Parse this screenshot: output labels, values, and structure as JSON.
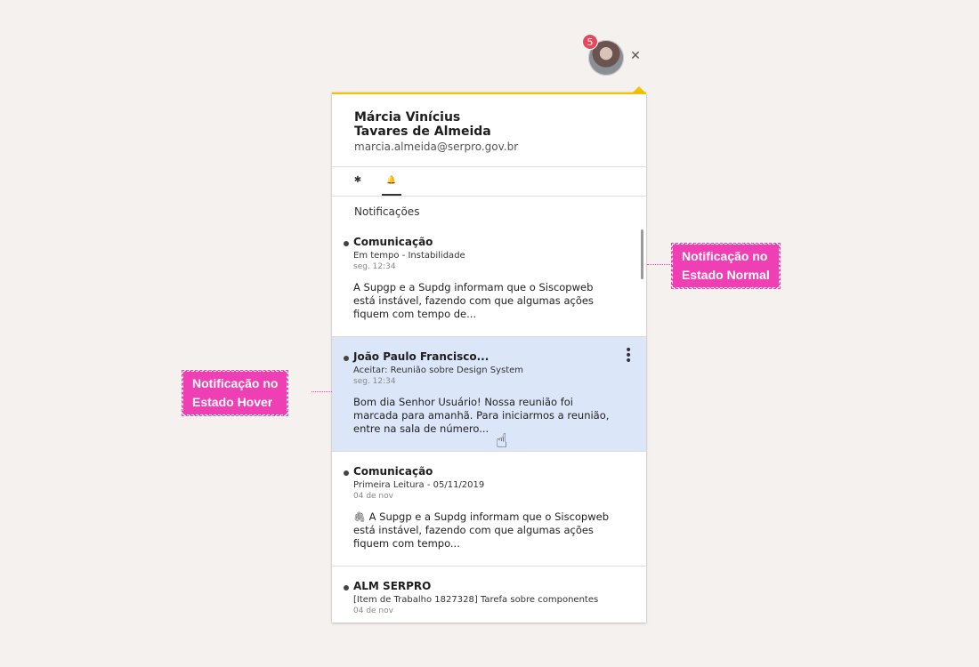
{
  "header": {
    "badge_count": "5",
    "avatar_icon": "user-avatar-icon",
    "close_icon": "close-icon",
    "close_glyph": "✕",
    "accent_color": "#f5c400",
    "badge_color": "#e8475b"
  },
  "user": {
    "name_line1": "Márcia Vinícius",
    "name_line2": "Tavares de Almeida",
    "email": "marcia.almeida@serpro.gov.br"
  },
  "tabs": [
    {
      "icon": "gear-icon",
      "glyph": "✱",
      "active": false
    },
    {
      "icon": "bell-icon",
      "glyph": "🔔",
      "active": true
    }
  ],
  "section_title": "Notificações",
  "notifications": [
    {
      "title": "Comunicação",
      "subtitle": "Em tempo - Instabilidade",
      "time": "seg. 12:34",
      "body": "A Supgp e a Supdg informam que o Siscopweb está instável, fazendo com que algumas ações fiquem com tempo de...",
      "state": "normal"
    },
    {
      "title": "João Paulo Francisco...",
      "subtitle": "Aceitar: Reunião sobre Design System",
      "time": "seg. 12:34",
      "body": "Bom dia Senhor Usuário!  Nossa reunião foi marcada para amanhã. Para iniciarmos a reunião, entre na sala de número...",
      "state": "hover",
      "hover_color": "#dbe6f8"
    },
    {
      "title": "Comunicação",
      "subtitle": "Primeira Leitura - 05/11/2019",
      "time": "04 de nov",
      "body": "A Supgp e a Supdg informam que o Siscopweb está instável, fazendo com que algumas ações fiquem com tempo...",
      "attachment_icon": "paperclip-icon",
      "attachment_glyph": "🖇",
      "state": "normal"
    },
    {
      "title": "ALM SERPRO",
      "subtitle": "[Item de Trabalho 1827328] Tarefa sobre componentes",
      "time": "04 de nov",
      "body": "",
      "state": "normal"
    }
  ],
  "annotations": {
    "normal": {
      "line1": "Notificação no",
      "line2": "Estado Normal"
    },
    "hover": {
      "line1": "Notificação no",
      "line2": "Estado Hover"
    },
    "color": "#ee3fb4"
  },
  "cursor": {
    "icon": "hand-cursor-icon",
    "glyph": "☝"
  }
}
